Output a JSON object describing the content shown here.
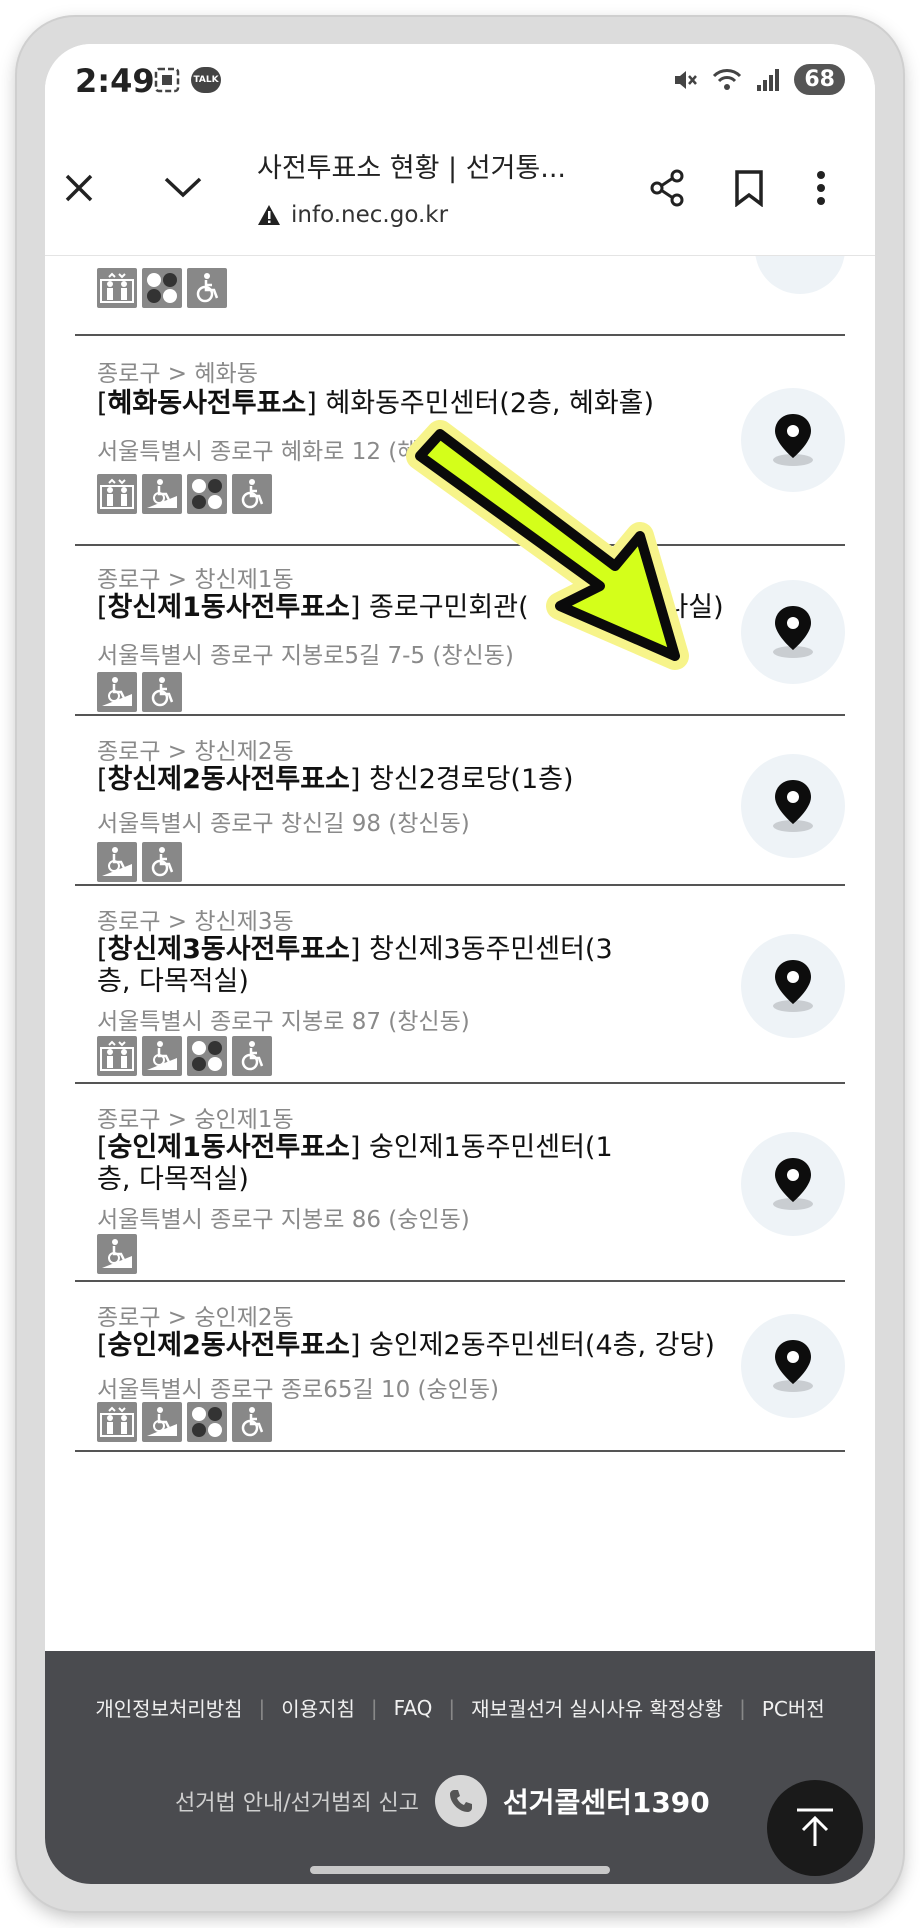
{
  "status_bar": {
    "time": "2:49",
    "battery": "68",
    "kakao_label": "TALK"
  },
  "toolbar": {
    "title": "사전투표소 현황 | 선거통...",
    "url": "info.nec.go.kr"
  },
  "items": [
    {
      "region": "",
      "name": "",
      "place": "",
      "address": "",
      "badges": [
        "elevator",
        "braille",
        "wheelchair"
      ]
    },
    {
      "region": "종로구 > 혜화동",
      "name": "혜화동사전투표소",
      "place": " 혜화동주민센터(2층, 혜화홀)",
      "address": "서울특별시 종로구 혜화로 12 (혜화동)",
      "badges": [
        "elevator",
        "ramp",
        "braille",
        "wheelchair"
      ]
    },
    {
      "region": "종로구 > 창신제1동",
      "name": "창신제1동사전투표소",
      "place": " 종로구민회관(",
      "place_tail": "미나실)",
      "address": "서울특별시 종로구 지봉로5길 7-5 (창신동)",
      "badges": [
        "ramp",
        "wheelchair"
      ]
    },
    {
      "region": "종로구 > 창신제2동",
      "name": "창신제2동사전투표소",
      "place": " 창신2경로당(1층)",
      "address": "서울특별시 종로구 창신길 98 (창신동)",
      "badges": [
        "ramp",
        "wheelchair"
      ]
    },
    {
      "region": "종로구 > 창신제3동",
      "name": "창신제3동사전투표소",
      "place": " 창신제3동주민센터(3층, 다목적실)",
      "address": "서울특별시 종로구 지봉로 87 (창신동)",
      "badges": [
        "elevator",
        "ramp",
        "braille",
        "wheelchair"
      ]
    },
    {
      "region": "종로구 > 숭인제1동",
      "name": "숭인제1동사전투표소",
      "place": " 숭인제1동주민센터(1층, 다목적실)",
      "address": "서울특별시 종로구 지봉로 86 (숭인동)",
      "badges": [
        "ramp"
      ]
    },
    {
      "region": "종로구 > 숭인제2동",
      "name": "숭인제2동사전투표소",
      "place": " 숭인제2동주민센터(4층, 강당)",
      "address": "서울특별시 종로구 종로65길 10 (숭인동)",
      "badges": [
        "elevator",
        "ramp",
        "braille",
        "wheelchair"
      ]
    }
  ],
  "footer": {
    "links": [
      "개인정보처리방침",
      "이용지침",
      "FAQ",
      "재보궐선거 실시사유 확정상황",
      "PC버전"
    ],
    "law_text": "선거법 안내/선거범죄 신고",
    "callcenter": "선거콜센터1390"
  },
  "colors": {
    "footer_bg": "#4a4b4f",
    "badge": "#888888",
    "map_btn_bg": "#eef3f7",
    "arrow_fill": "#d4ff1a",
    "arrow_glow": "#f7f48a"
  }
}
